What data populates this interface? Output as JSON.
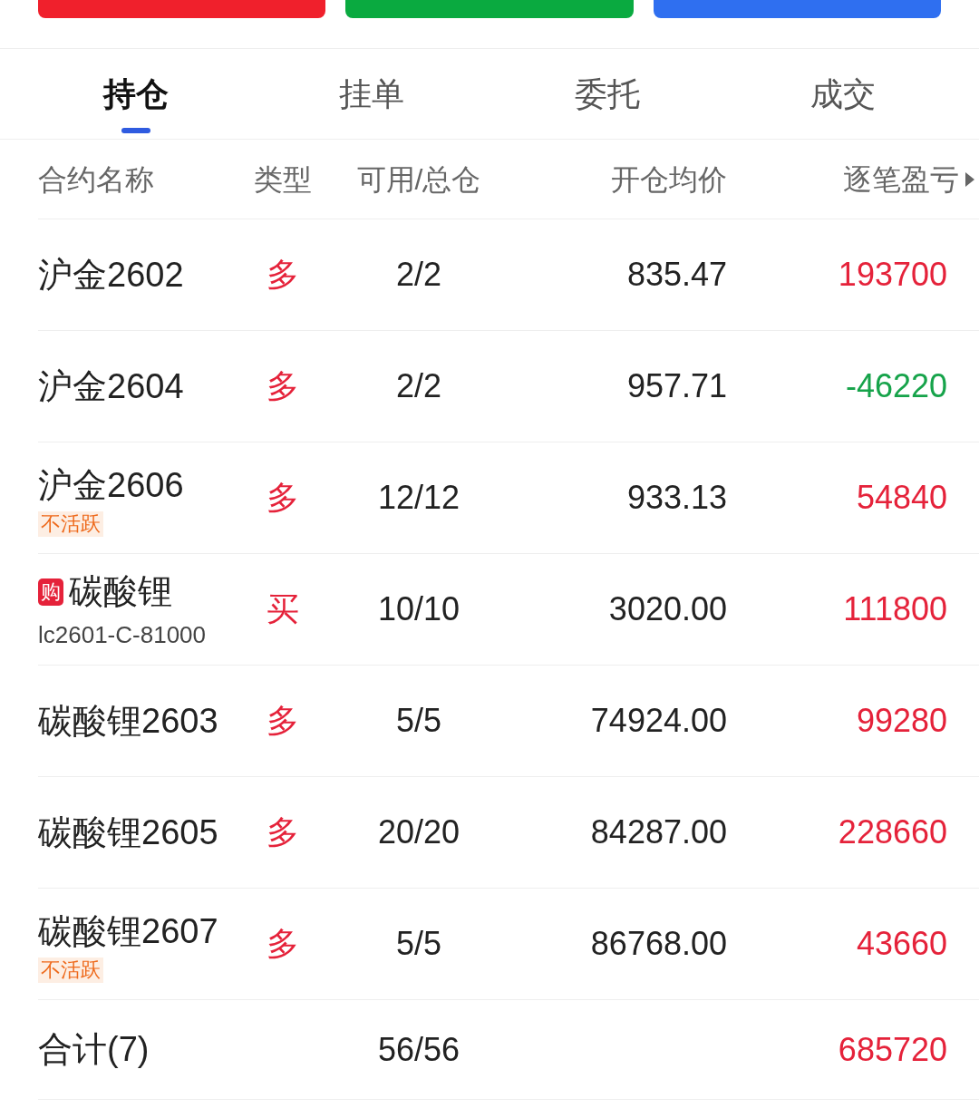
{
  "top_buttons": [
    {
      "color": "#f0202c"
    },
    {
      "color": "#0aaa40"
    },
    {
      "color": "#2f6ff0"
    }
  ],
  "tabs": [
    {
      "label": "持仓",
      "selected": true
    },
    {
      "label": "挂单",
      "selected": false
    },
    {
      "label": "委托",
      "selected": false
    },
    {
      "label": "成交",
      "selected": false
    }
  ],
  "columns": [
    "合约名称",
    "类型",
    "可用/总仓",
    "开仓均价",
    "逐笔盈亏"
  ],
  "rows": [
    {
      "name": "沪金2602",
      "type": "多",
      "available": "2/2",
      "avg_price": "835.47",
      "pnl": "193700",
      "color": "#e5223a"
    },
    {
      "name": "沪金2604",
      "type": "多",
      "available": "2/2",
      "avg_price": "957.71",
      "pnl": "-46220",
      "color": "#16a34a"
    },
    {
      "name": "沪金2606",
      "tag": "不活跃",
      "type": "多",
      "available": "12/12",
      "avg_price": "933.13",
      "pnl": "54840",
      "color": "#e5223a"
    },
    {
      "name": "碳酸锂",
      "badge": "购",
      "code": "lc2601-C-81000",
      "type": "买",
      "available": "10/10",
      "avg_price": "3020.00",
      "pnl": "111800",
      "color": "#e5223a"
    },
    {
      "name": "碳酸锂2603",
      "type": "多",
      "available": "5/5",
      "avg_price": "74924.00",
      "pnl": "99280",
      "color": "#e5223a"
    },
    {
      "name": "碳酸锂2605",
      "type": "多",
      "available": "20/20",
      "avg_price": "84287.00",
      "pnl": "228660",
      "color": "#e5223a"
    },
    {
      "name": "碳酸锂2607",
      "tag": "不活跃",
      "type": "多",
      "available": "5/5",
      "avg_price": "86768.00",
      "pnl": "43660",
      "color": "#e5223a"
    }
  ],
  "total": {
    "label": "合计(7)",
    "available": "56/56",
    "pnl": "685720",
    "color": "#e5223a"
  }
}
